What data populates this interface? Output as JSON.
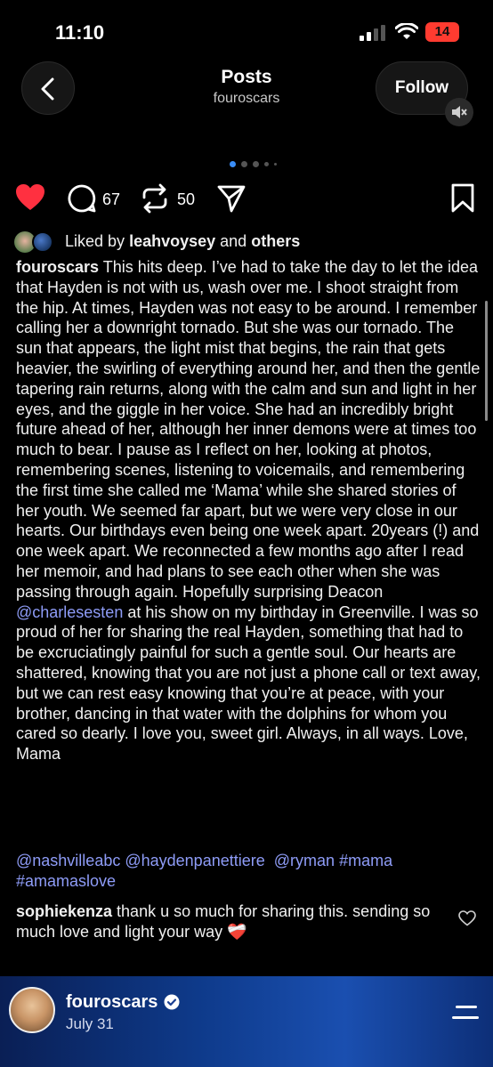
{
  "status_bar": {
    "time": "11:10",
    "battery": "14"
  },
  "header": {
    "title": "Posts",
    "username": "fouroscars",
    "follow_label": "Follow"
  },
  "colors": {
    "like_red": "#ff3040",
    "link_blue": "#8e9cf7",
    "battery_red": "#ff3b30"
  },
  "actions": {
    "comment_count": "67",
    "repost_count": "50"
  },
  "icons": [
    "back-chevron-icon",
    "mute-icon",
    "heart-icon",
    "comment-icon",
    "repost-icon",
    "share-icon",
    "bookmark-icon",
    "verified-icon",
    "menu-icon"
  ],
  "liked_by": {
    "prefix": "Liked by",
    "user": "leahvoysey",
    "and": "and",
    "others": "others"
  },
  "caption": {
    "username": "fouroscars",
    "text_before_mention": " This hits deep. I’ve had to take the day to let the idea that Hayden is not with us, wash over me. I shoot straight from the hip. At times, Hayden was not easy to be around. I remember calling her a downright tornado. But she was our tornado. The sun that appears, the light mist that begins, the rain that gets heavier, the swirling of everything around her, and then the gentle tapering rain returns, along with the calm and sun and light in her eyes, and the giggle in her voice. She had an incredibly bright future ahead of her, although her inner demons were at times too much to bear. I pause as I reflect on her, looking at photos, remembering scenes, listening to voicemails, and remembering the first time she called me ‘Mama’ while she shared stories of her youth. We seemed far apart, but we were very close in our hearts. Our birthdays even being one week apart. 20years (!) and one week apart. We reconnected a few months ago after I read her memoir, and had plans to see each other when she was passing through again. Hopefully surprising Deacon ",
    "mention": "@charlesesten",
    "text_after_mention": " at his show on my birthday in Greenville. I was so proud of her for sharing the real Hayden, something that had to be excruciatingly painful for such a gentle soul. Our hearts are shattered, knowing that you are not just a phone call or text away, but we can rest easy knowing that you’re at peace, with your brother, dancing in that water with the dolphins for whom you cared so dearly. I love you, sweet girl. Always, in all ways. Love, Mama"
  },
  "tags": {
    "t1": "@nashvilleabc",
    "t2": "@haydenpanettiere",
    "t3": "@ryman",
    "t4": "#mama",
    "t5": "#amamaslove"
  },
  "comment": {
    "username": "sophiekenza",
    "text": " thank u so much for sharing this. sending so much love and light your way ❤️‍🩹"
  },
  "footer": {
    "username": "fouroscars",
    "date": "July 31"
  }
}
